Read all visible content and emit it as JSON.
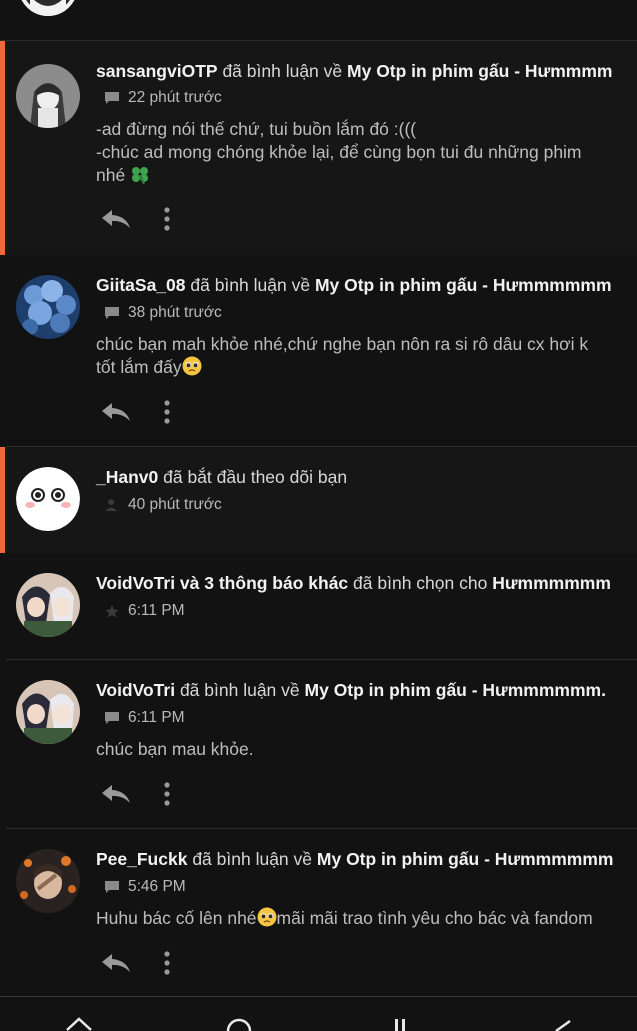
{
  "notifications": [
    {
      "user": "sansangviOTP",
      "action": "đã bình luận về",
      "target": "My Otp in phim gấu - Hưmmmm",
      "time": "22 phút trước",
      "lines": [
        "-ad đừng nói thế chứ, tui buồn lắm đó :(((",
        "-chúc ad mong chóng khỏe lại, để cùng bọn tui đu những phim",
        "nhé"
      ],
      "emoji": "four-leaf-clover",
      "unread": true,
      "meta_icon": "comment-icon"
    },
    {
      "user": "GiitaSa_08",
      "action": "đã bình luận về",
      "target": "My Otp in phim gấu - Hưmmmmmm",
      "time": "38 phút trước",
      "lines": [
        "chúc bạn mah khỏe nhé,chứ nghe bạn nôn ra si rô dâu cx hơi k",
        "tốt lắm đấy"
      ],
      "emoji": "pleading-face",
      "unread": false,
      "meta_icon": "comment-icon"
    },
    {
      "user": "_Hanv0",
      "action": "đã bắt đầu theo dõi bạn",
      "time": "40 phút trước",
      "unread": true,
      "meta_icon": "follow-icon"
    },
    {
      "user": "VoidVoTri và 3 thông báo khác",
      "action": "đã bình chọn cho",
      "target": "Hưmmmmmm",
      "time": "6:11 PM",
      "unread": false,
      "meta_icon": "star-icon"
    },
    {
      "user": "VoidVoTri",
      "action": "đã bình luận về",
      "target": "My Otp in phim gấu - Hưmmmmmm.",
      "time": "6:11 PM",
      "lines": [
        "chúc bạn mau khỏe."
      ],
      "unread": false,
      "meta_icon": "comment-icon"
    },
    {
      "user": "Pee_Fuckk",
      "action": "đã bình luận về",
      "target": "My Otp in phim gấu - Hưmmmmmm",
      "time": "5:46 PM",
      "lines_before_emoji": "Huhu bác cố lên nhé",
      "lines_after_emoji": "mãi mãi trao tình yêu cho bác và fandom",
      "emoji": "pleading-face",
      "unread": false,
      "meta_icon": "comment-icon"
    }
  ],
  "colors": {
    "background": "#121212",
    "unread_accent": "#f0683a",
    "text_primary": "#f2f2f2",
    "text_secondary": "#bdbdbd"
  }
}
